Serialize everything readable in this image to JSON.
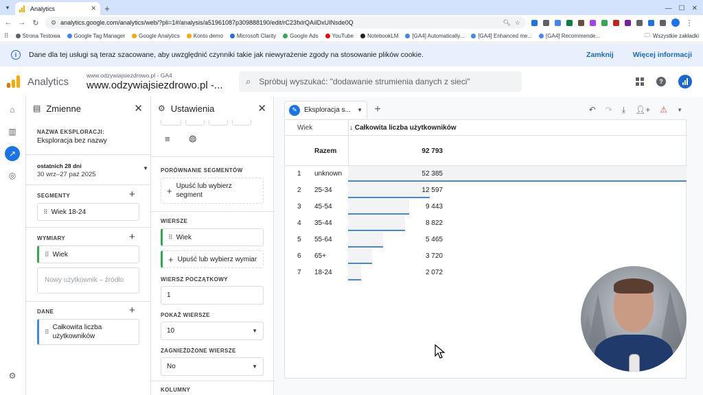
{
  "browser": {
    "tab_title": "Analytics",
    "url": "analytics.google.com/analytics/web/?pli=1#/analysis/a51961087p309888190/edit/rC23fxlrQAiIDxUINsde0Q",
    "bookmarks": [
      {
        "label": "Strona Testowa",
        "color": "#5f6368"
      },
      {
        "label": "Google Tag Manager",
        "color": "#4285f4"
      },
      {
        "label": "Google Analytics",
        "color": "#f9ab00"
      },
      {
        "label": "Konto demo",
        "color": "#f9ab00"
      },
      {
        "label": "Microsoft Clarity",
        "color": "#1a73e8"
      },
      {
        "label": "Google Ads",
        "color": "#34a853"
      },
      {
        "label": "YouTube",
        "color": "#ff0000"
      },
      {
        "label": "NotebookLM",
        "color": "#202124"
      },
      {
        "label": "[GA4] Automatically...",
        "color": "#4285f4"
      },
      {
        "label": "[GA4] Enhanced me...",
        "color": "#4285f4"
      },
      {
        "label": "[GA4] Recommende...",
        "color": "#4285f4"
      }
    ],
    "all_bookmarks": "Wszystkie zakładki"
  },
  "banner": {
    "text": "Dane dla tej usługi są teraz szacowane, aby uwzględnić czynniki takie jak niewyrażenie zgody na stosowanie plików cookie.",
    "close_label": "Zamknij",
    "more_label": "Więcej informacji"
  },
  "header": {
    "brand": "Analytics",
    "property_small": "www.odzywiajsiezdrowo.pl - GA4",
    "property_big": "www.odzywiajsiezdrowo.pl -...",
    "search_placeholder": "Spróbuj wyszukać: \"dodawanie strumienia danych z sieci\""
  },
  "variables": {
    "title": "Zmienne",
    "name_label": "NAZWA EKSPLORACJI:",
    "name_value": "Eksploracja bez nazwy",
    "date_label": "ostatnich 28 dni",
    "date_range": "30 wrz–27 paź 2025",
    "segments_label": "SEGMENTY",
    "segment_item": "Wiek 18-24",
    "dimensions_label": "WYMIARY",
    "dimension_item": "Wiek",
    "dimension_placeholder": "Nowy użytkownik – źródło",
    "metrics_label": "DANE",
    "metric_item": "Całkowita liczba użytkowników"
  },
  "settings": {
    "title": "Ustawienia",
    "segment_compare_label": "PORÓWNANIE SEGMENTÓW",
    "segment_drop": "Upuść lub wybierz segment",
    "rows_label": "WIERSZE",
    "row_item": "Wiek",
    "row_drop": "Upuść lub wybierz wymiar",
    "start_row_label": "WIERSZ POCZĄTKOWY",
    "start_row_value": "1",
    "show_rows_label": "POKAŻ WIERSZE",
    "show_rows_value": "10",
    "nested_rows_label": "ZAGNIEŻDŻONE WIERSZE",
    "nested_rows_value": "No",
    "columns_label": "KOLUMNY"
  },
  "exploration": {
    "tab_name": "Eksploracja s...",
    "col_dimension": "Wiek",
    "col_metric": "↓ Całkowita liczba użytkowników",
    "total_label": "Razem",
    "total_value": "92 793",
    "rows": [
      {
        "n": "1",
        "label": "unknown",
        "value": "52 385",
        "num": 52385
      },
      {
        "n": "2",
        "label": "25-34",
        "value": "12 597",
        "num": 12597
      },
      {
        "n": "3",
        "label": "45-54",
        "value": "9 443",
        "num": 9443
      },
      {
        "n": "4",
        "label": "35-44",
        "value": "8 822",
        "num": 8822
      },
      {
        "n": "5",
        "label": "55-64",
        "value": "5 465",
        "num": 5465
      },
      {
        "n": "6",
        "label": "65+",
        "value": "3 720",
        "num": 3720
      },
      {
        "n": "7",
        "label": "18-24",
        "value": "2 072",
        "num": 2072
      }
    ]
  }
}
